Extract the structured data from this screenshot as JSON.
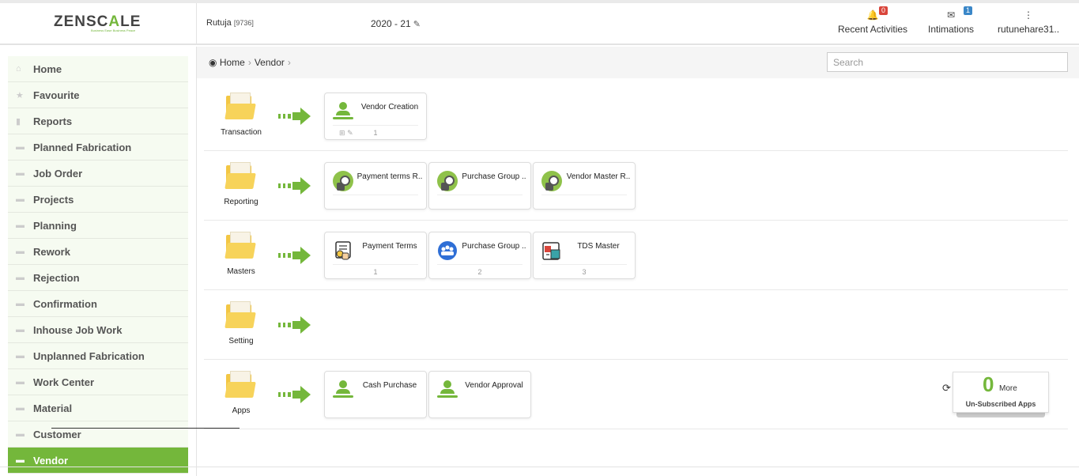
{
  "header": {
    "logo_text_1": "ZENSC",
    "logo_text_2": "A",
    "logo_text_3": "LE",
    "tagline": "Business Ease Business Peace",
    "user_name": "Rutuja",
    "user_id": "[9736]",
    "financial_year": "2020 - 21",
    "recent_activities_label": "Recent Activities",
    "recent_activities_count": "0",
    "intimations_label": "Intimations",
    "intimations_count": "1",
    "account_label": "rutunehare31.."
  },
  "sidebar": {
    "items": [
      {
        "label": "Home",
        "icon": "home-icon"
      },
      {
        "label": "Favourite",
        "icon": "star-icon"
      },
      {
        "label": "Reports",
        "icon": "file-icon"
      },
      {
        "label": "Planned Fabrication",
        "icon": "folder-icon"
      },
      {
        "label": "Job Order",
        "icon": "folder-icon"
      },
      {
        "label": "Projects",
        "icon": "folder-icon"
      },
      {
        "label": "Planning",
        "icon": "folder-icon"
      },
      {
        "label": "Rework",
        "icon": "folder-icon"
      },
      {
        "label": "Rejection",
        "icon": "folder-icon"
      },
      {
        "label": "Confirmation",
        "icon": "folder-icon"
      },
      {
        "label": "Inhouse Job Work",
        "icon": "folder-icon"
      },
      {
        "label": "Unplanned Fabrication",
        "icon": "folder-icon"
      },
      {
        "label": "Work Center",
        "icon": "folder-icon"
      },
      {
        "label": "Material",
        "icon": "folder-icon"
      },
      {
        "label": "Customer",
        "icon": "folder-icon"
      },
      {
        "label": "Vendor",
        "icon": "folder-icon",
        "active": true
      }
    ]
  },
  "breadcrumb": {
    "home": "Home",
    "current": "Vendor"
  },
  "search": {
    "placeholder": "Search"
  },
  "sections": {
    "transaction": {
      "label": "Transaction",
      "cards": [
        {
          "title": "Vendor Creation",
          "count": "1"
        }
      ]
    },
    "reporting": {
      "label": "Reporting",
      "cards": [
        {
          "title": "Payment terms R.."
        },
        {
          "title": "Purchase Group .."
        },
        {
          "title": "Vendor Master R.."
        }
      ]
    },
    "masters": {
      "label": "Masters",
      "cards": [
        {
          "title": "Payment Terms",
          "count": "1"
        },
        {
          "title": "Purchase Group ..",
          "count": "2"
        },
        {
          "title": "TDS Master",
          "count": "3"
        }
      ]
    },
    "setting": {
      "label": "Setting",
      "cards": []
    },
    "apps": {
      "label": "Apps",
      "cards": [
        {
          "title": "Cash Purchase"
        },
        {
          "title": "Vendor Approval"
        }
      ]
    }
  },
  "unsubscribed": {
    "count": "0",
    "more_label": "More",
    "caption": "Un-Subscribed Apps"
  },
  "colors": {
    "accent": "#74b73b",
    "folder": "#f3c744",
    "badge_red": "#d9453b",
    "badge_blue": "#3a87c8"
  }
}
